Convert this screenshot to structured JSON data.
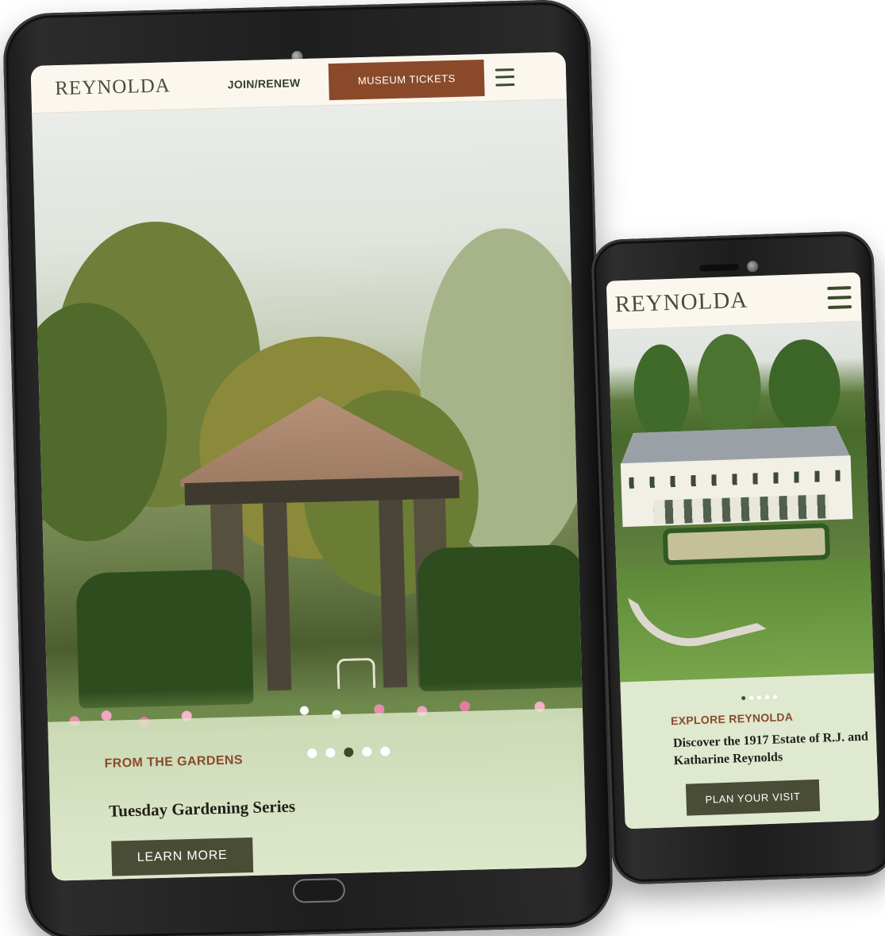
{
  "tablet": {
    "header": {
      "brand": "REYNOLDA",
      "join_label": "JOIN/RENEW",
      "tickets_label": "MUSEUM TICKETS",
      "menu_icon": "hamburger-icon"
    },
    "slide": {
      "kicker": "FROM THE GARDENS",
      "title": "Tuesday Gardening Series",
      "cta_label": "LEARN MORE",
      "slide_count": 5,
      "active_slide": 3
    }
  },
  "phone": {
    "header": {
      "brand": "REYNOLDA",
      "menu_icon": "hamburger-icon"
    },
    "slide": {
      "kicker": "EXPLORE REYNOLDA",
      "title": "Discover the 1917 Estate of R.J. and Katharine Reynolds",
      "cta_label": "PLAN YOUR VISIT",
      "slide_count": 5,
      "active_slide": 1
    }
  },
  "colors": {
    "accent_brown": "#8a4a2a",
    "button_olive": "#4a4d36",
    "header_cream": "#fbf7ee",
    "icon_green": "#3b4a2b",
    "panel_sage": "#dfe9d0"
  }
}
